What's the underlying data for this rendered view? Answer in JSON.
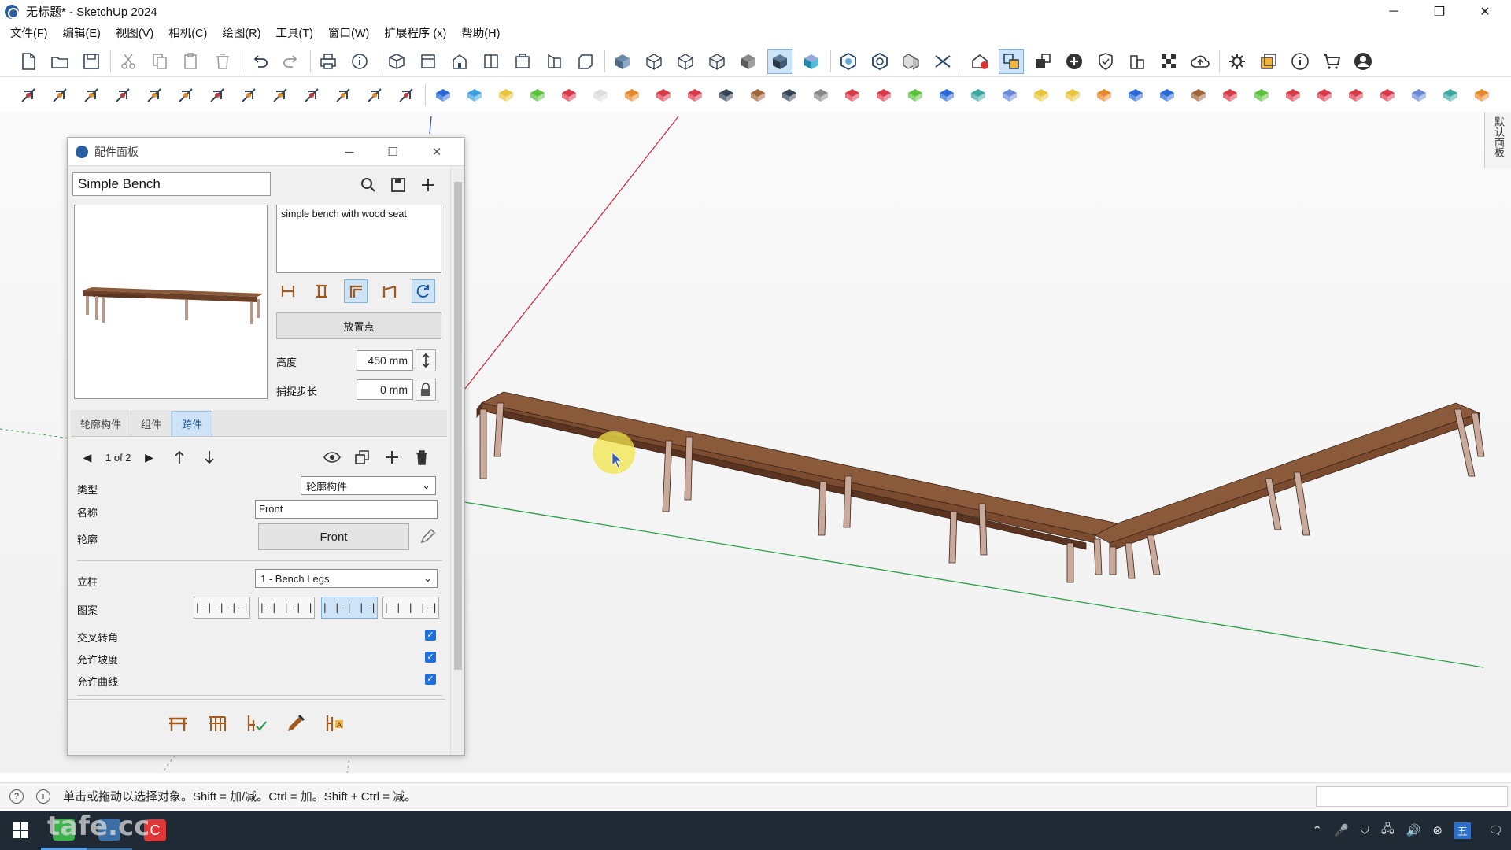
{
  "window": {
    "title": "无标题* - SketchUp 2024",
    "minimize": "─",
    "maximize": "❐",
    "close": "✕"
  },
  "menu": [
    "文件(F)",
    "编辑(E)",
    "视图(V)",
    "相机(C)",
    "绘图(R)",
    "工具(T)",
    "窗口(W)",
    "扩展程序 (x)",
    "帮助(H)"
  ],
  "side_tab": "默认面板",
  "panel": {
    "title": "配件面板",
    "name_value": "Simple Bench",
    "description": "simple bench with wood seat",
    "place_button": "放置点",
    "height_label": "高度",
    "height_value": "450 mm",
    "snap_label": "捕捉步长",
    "snap_value": "0 mm",
    "tabs": [
      "轮廓构件",
      "组件",
      "跨件"
    ],
    "active_tab": 2,
    "pager": "1 of 2",
    "type_label": "类型",
    "type_value": "轮廓构件",
    "name_label": "名称",
    "name_field": "Front",
    "profile_label": "轮廓",
    "profile_button": "Front",
    "post_label": "立柱",
    "post_value": "1 - Bench Legs",
    "pattern_label": "图案",
    "patterns": [
      "|-|-|-|-|",
      "|-| |-| |",
      "| |-| |-|",
      "|-| | |-|"
    ],
    "active_pattern": 2,
    "checks": [
      {
        "label": "交叉转角",
        "checked": true
      },
      {
        "label": "允许坡度",
        "checked": true
      },
      {
        "label": "允许曲线",
        "checked": true
      }
    ]
  },
  "status": {
    "message": "单击或拖动以选择对象。Shift = 加/减。Ctrl = 加。Shift + Ctrl = 减。"
  },
  "taskbar": {
    "watermark": "tafe.cc",
    "tray_ime": "五"
  },
  "colors": {
    "accent": "#1e6fd9",
    "bench_wood": "#7a4b2e",
    "bench_leg": "#c9a99a",
    "axis_red": "#d03040",
    "axis_green": "#2aa04a"
  }
}
